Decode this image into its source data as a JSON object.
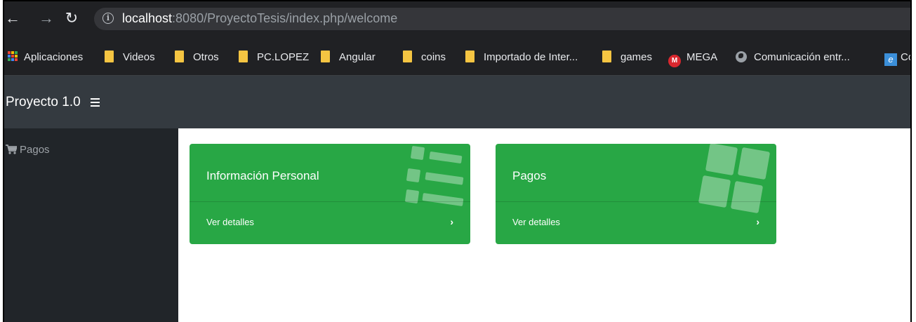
{
  "browser": {
    "url_host": "localhost",
    "url_rest": ":8080/ProyectoTesis/index.php/welcome",
    "bookmarks": [
      {
        "label": "Aplicaciones",
        "icon": "apps-icon"
      },
      {
        "label": "Videos",
        "icon": "folder-icon"
      },
      {
        "label": "Otros",
        "icon": "folder-icon"
      },
      {
        "label": "PC.LOPEZ",
        "icon": "folder-icon"
      },
      {
        "label": "Angular",
        "icon": "folder-icon"
      },
      {
        "label": "coins",
        "icon": "folder-icon"
      },
      {
        "label": "Importado de Inter...",
        "icon": "folder-icon"
      },
      {
        "label": "games",
        "icon": "folder-icon"
      },
      {
        "label": "MEGA",
        "icon": "mega-icon"
      },
      {
        "label": "Comunicación entr...",
        "icon": "globe-icon"
      },
      {
        "label": "Co",
        "icon": "e-icon"
      }
    ],
    "mega_letter": "M",
    "e_letter": "e"
  },
  "navbar": {
    "brand": "Proyecto 1.0"
  },
  "sidebar": {
    "items": [
      {
        "label": "Pagos",
        "icon": "cart-icon"
      }
    ]
  },
  "cards": [
    {
      "title": "Información Personal",
      "footer": "Ver detalles",
      "icon": "list-icon"
    },
    {
      "title": "Pagos",
      "footer": "Ver detalles",
      "icon": "grid-icon"
    }
  ],
  "colors": {
    "card_green": "#28a745",
    "navbar": "#343a40",
    "sidebar": "#212529",
    "browser_chrome": "#202124"
  }
}
